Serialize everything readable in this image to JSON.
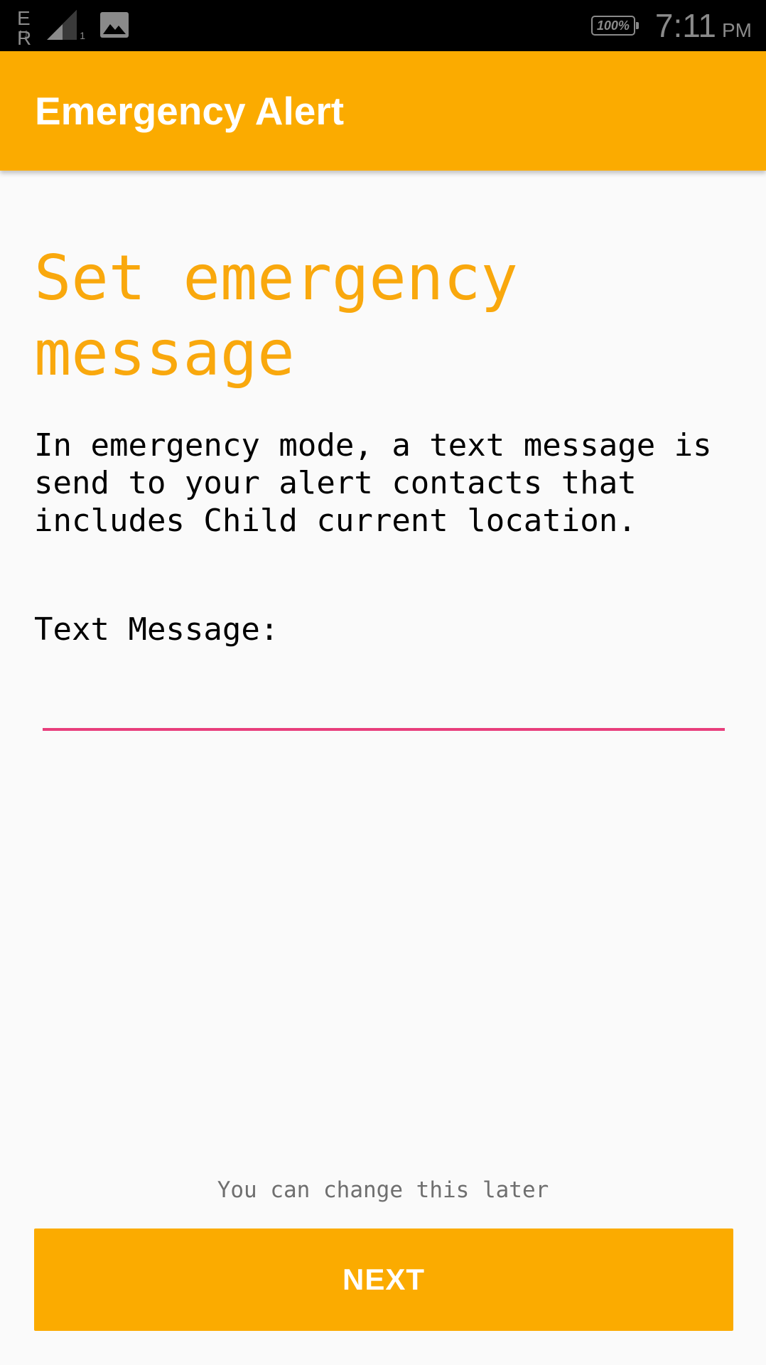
{
  "status_bar": {
    "network_label": "E R",
    "network_arrows": "↑↓",
    "sim_number": "1",
    "battery_level": "100%",
    "time": "7:11",
    "ampm": "PM",
    "icons": [
      "data-activity-icon",
      "signal-icon",
      "image-notification-icon",
      "battery-icon"
    ]
  },
  "app_bar": {
    "title": "Emergency Alert"
  },
  "main": {
    "heading": "Set emergency message",
    "description": "In emergency mode, a text message is send to your alert contacts that includes Child current location.",
    "field_label": "Text Message:",
    "message_value": "",
    "message_placeholder": "",
    "hint": "You can change this later",
    "next_label": "NEXT"
  },
  "colors": {
    "accent": "#fbab00",
    "heading": "#f9a80d",
    "input_underline": "#e83e7c",
    "background": "#fafafa",
    "status_bar": "#000000"
  }
}
